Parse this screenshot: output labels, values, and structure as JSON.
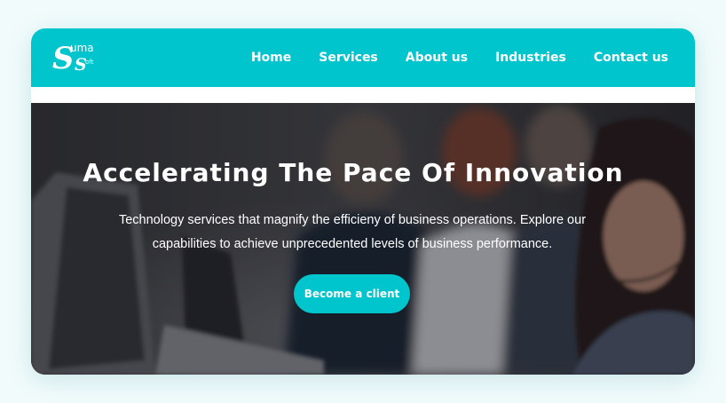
{
  "brand": {
    "logo_text": "Suma Soft",
    "logo_letters": [
      "S",
      "uma",
      "S",
      "oft"
    ]
  },
  "nav": {
    "items": [
      {
        "label": "Home"
      },
      {
        "label": "Services"
      },
      {
        "label": "About us"
      },
      {
        "label": "Industries"
      },
      {
        "label": "Contact us"
      }
    ]
  },
  "hero": {
    "title": "Accelerating The Pace Of Innovation",
    "description": "Technology services that magnify the efficieny of business operations. Explore our capabilities to achieve unprecedented levels of business performance.",
    "cta_label": "Become a client"
  },
  "colors": {
    "accent": "#00c5cd",
    "page_background": "#f1fbfc",
    "text_on_accent": "#ffffff"
  }
}
